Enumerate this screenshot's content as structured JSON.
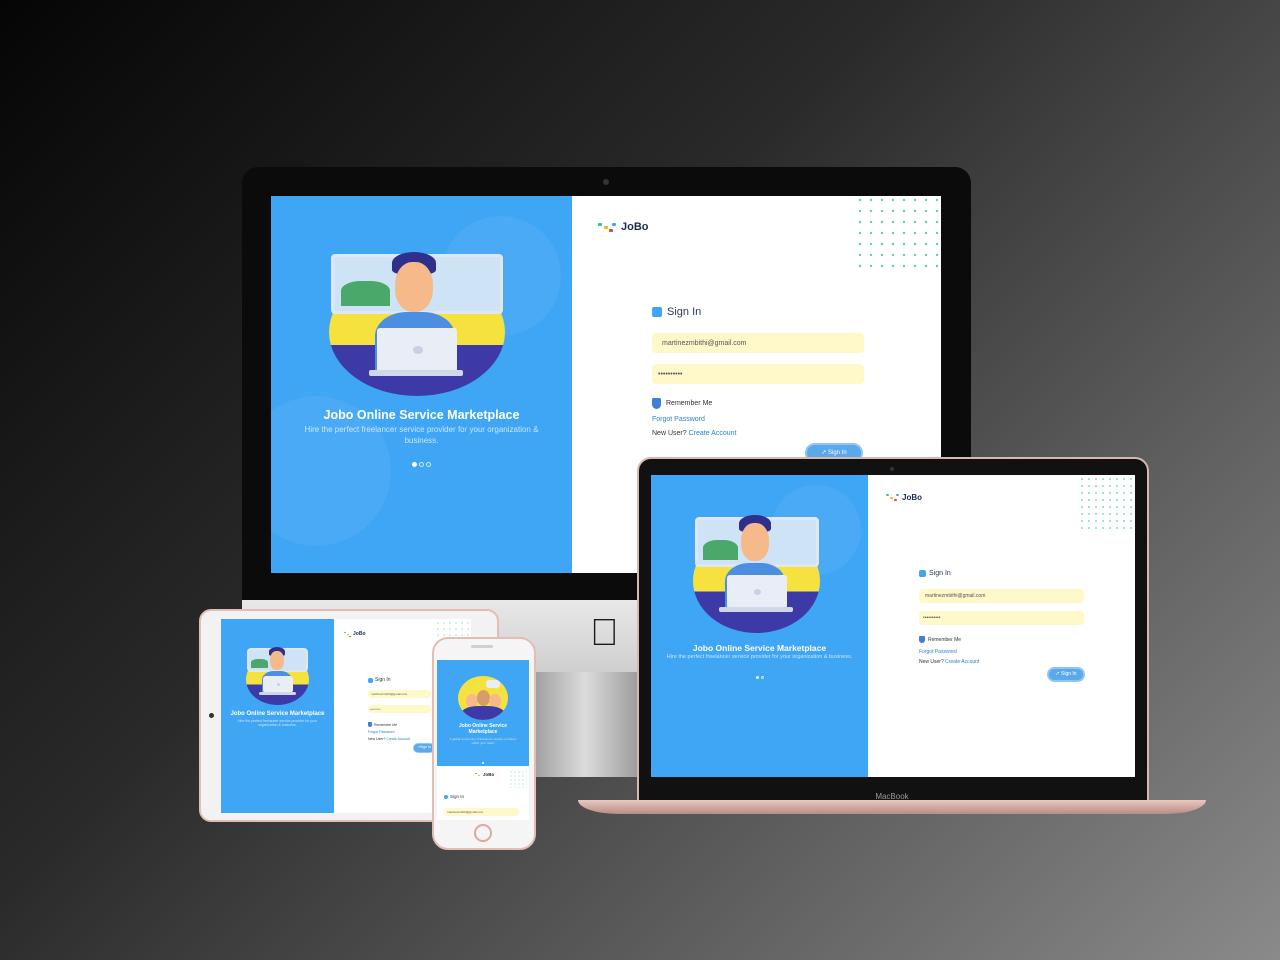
{
  "brand": {
    "name": "JoBo"
  },
  "hero": {
    "title": "Jobo Online Service Marketplace",
    "subtitle": "Hire the perfect freelancer service provider for your organization & business.",
    "phone_subtitle": "A global community of freelancer service providers within your reach"
  },
  "signin": {
    "title": "Sign In",
    "email_value": "martinezmbithi@gmail.com",
    "password_value": "••••••••••",
    "remember_label": "Remember Me",
    "forgot_label": "Forgot Password",
    "new_user_prefix": "New User?",
    "create_account_label": "Create Account",
    "button_label": "Sign In",
    "button_icon": "key-icon"
  },
  "device": {
    "macbook_label": "MacBook"
  },
  "colors": {
    "hero_blue": "#3fa5f5",
    "field_yellow": "#fff8c8",
    "link_blue": "#2a7fd4",
    "dot_green": "#5fd0b0"
  }
}
